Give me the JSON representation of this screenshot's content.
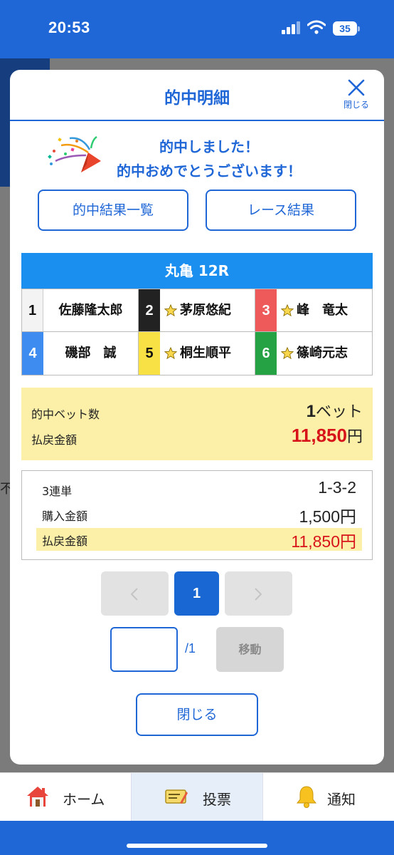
{
  "status_bar": {
    "time": "20:53",
    "battery": "35"
  },
  "background": {
    "partial_text": "不"
  },
  "modal": {
    "title": "的中明細",
    "close_icon_label": "閉じる",
    "congrats_line1": "的中しました！",
    "congrats_line2": "的中おめでとうございます！",
    "btn_hit_list": "的中結果一覧",
    "btn_race_result": "レース結果",
    "race": {
      "title": "丸亀 12R",
      "racers": [
        {
          "num": "1",
          "name": "佐藤隆太郎",
          "star": false,
          "bg": "#ffffff",
          "fg": "#111111"
        },
        {
          "num": "2",
          "name": "茅原悠紀",
          "star": true,
          "bg": "#222222",
          "fg": "#ffffff"
        },
        {
          "num": "3",
          "name": "峰　竜太",
          "star": true,
          "bg": "#ee5a5a",
          "fg": "#ffffff"
        },
        {
          "num": "4",
          "name": "磯部　誠",
          "star": false,
          "bg": "#3f8cf0",
          "fg": "#ffffff"
        },
        {
          "num": "5",
          "name": "桐生順平",
          "star": true,
          "bg": "#f7e144",
          "fg": "#111111"
        },
        {
          "num": "6",
          "name": "篠崎元志",
          "star": true,
          "bg": "#25a244",
          "fg": "#ffffff"
        }
      ]
    },
    "summary": {
      "hit_bets_label": "的中ベット数",
      "hit_bets_count": "1",
      "hit_bets_unit": "ベット",
      "payout_label": "払戻金額",
      "payout_value": "11,850",
      "payout_unit": "円"
    },
    "detail": {
      "bet_type": "3連単",
      "combination": "1-3-2",
      "purchase_label": "購入金額",
      "purchase_value": "1,500円",
      "payout_label": "払戻金額",
      "payout_value": "11,850円"
    },
    "pagination": {
      "current": "1",
      "input_value": "",
      "total": "/1",
      "move_label": "移動"
    },
    "close_button": "閉じる"
  },
  "bottom_nav": [
    {
      "label": "ホーム"
    },
    {
      "label": "投票"
    },
    {
      "label": "通知"
    }
  ],
  "colors": {
    "brand": "#1f66d6",
    "payout_red": "#d8141b",
    "highlight": "#fcefa8"
  }
}
